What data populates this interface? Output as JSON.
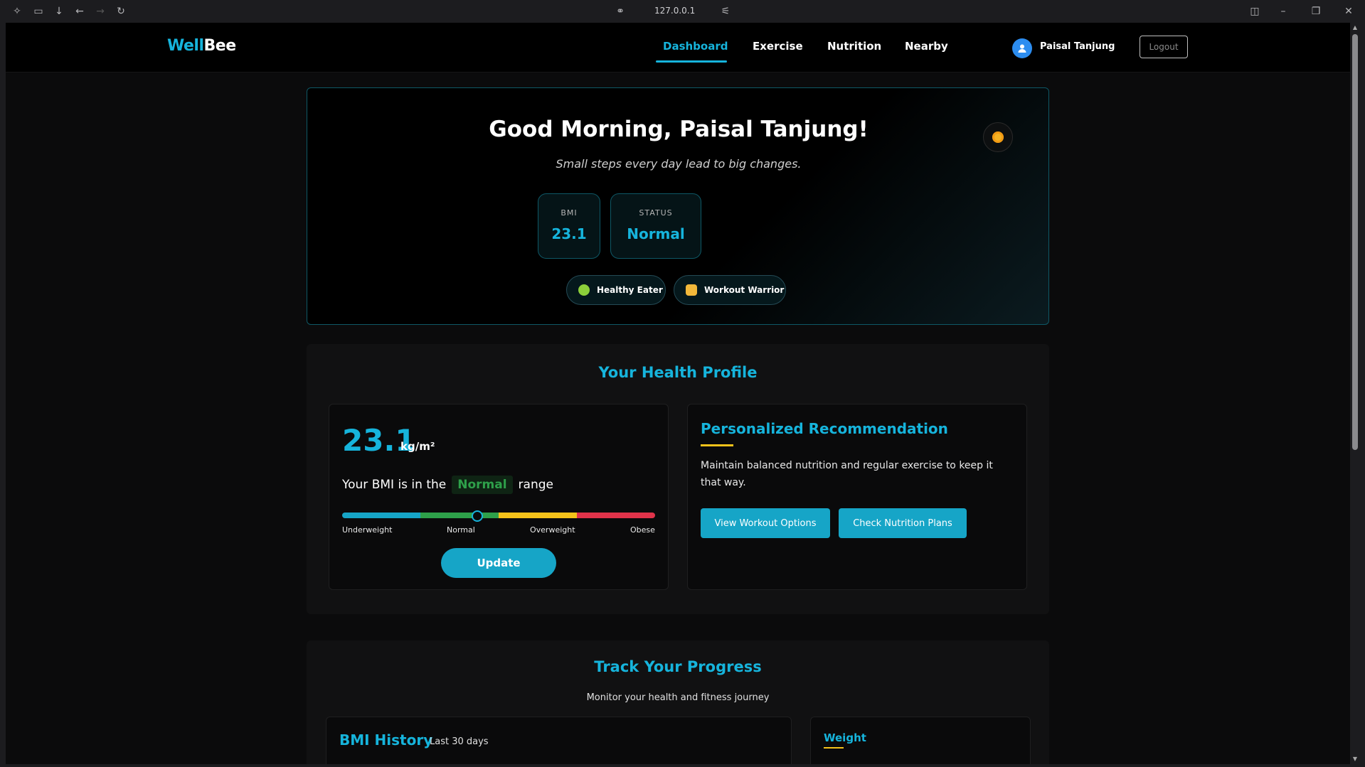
{
  "browser": {
    "url": "127.0.0.1"
  },
  "header": {
    "logo_part1": "Well",
    "logo_part2": "Bee",
    "nav": [
      "Dashboard",
      "Exercise",
      "Nutrition",
      "Nearby"
    ],
    "active_nav": "Dashboard",
    "user_name": "Paisal Tanjung",
    "logout_label": "Logout"
  },
  "welcome": {
    "greeting": "Good Morning, Paisal Tanjung!",
    "tagline": "Small steps every day lead to big changes.",
    "stats": [
      {
        "label": "BMI",
        "value": "23.1"
      },
      {
        "label": "STATUS",
        "value": "Normal"
      }
    ],
    "badges": [
      "Healthy Eater",
      "Workout Warrior"
    ]
  },
  "profile": {
    "title": "Your Health Profile",
    "bmi_value": "23.1",
    "bmi_unit": "kg/m²",
    "range_prefix": "Your BMI is in the",
    "range_value": "Normal",
    "range_suffix": "range",
    "scale_labels": [
      "Underweight",
      "Normal",
      "Overweight",
      "Obese"
    ],
    "update_label": "Update",
    "rec_title": "Personalized Recommendation",
    "rec_text": "Maintain balanced nutrition and regular exercise to keep it that way.",
    "rec_buttons": [
      "View Workout Options",
      "Check Nutrition Plans"
    ]
  },
  "progress": {
    "title": "Track Your Progress",
    "subtitle": "Monitor your health and fitness journey",
    "history_title": "BMI History",
    "history_sub": "Last 30 days",
    "weight_tab": "Weight"
  },
  "colors": {
    "accent": "#16b4dc",
    "normal_green": "#2ea04a",
    "warning_yellow": "#f5c21a",
    "danger_red": "#e0334a"
  }
}
